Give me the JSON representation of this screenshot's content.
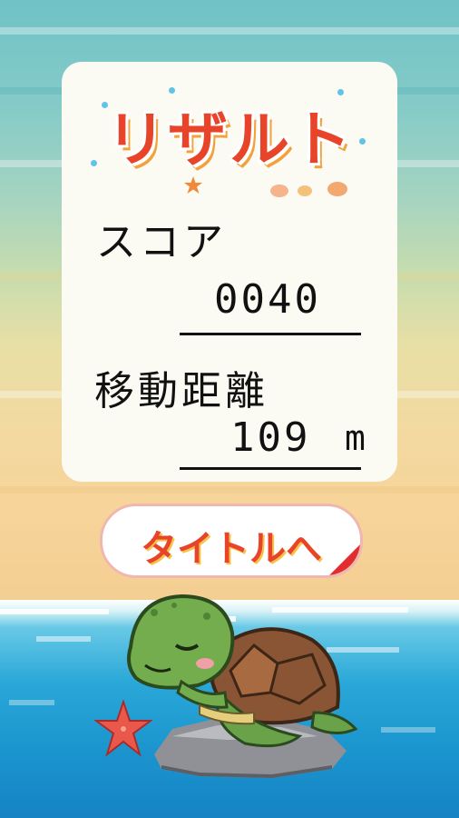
{
  "result": {
    "title": "リザルト",
    "score_label": "スコア",
    "score_value": "0040",
    "distance_label": "移動距離",
    "distance_value": "109",
    "distance_unit": "m"
  },
  "buttons": {
    "to_title": "タイトルへ"
  },
  "colors": {
    "accent_red": "#e8442a",
    "panel": "#fbfaf3",
    "sea": "#1c96cf",
    "sand": "#f4cf94"
  },
  "icons": {
    "character": "sea-turtle-icon",
    "starfish": "starfish-icon",
    "rock": "rock-icon"
  }
}
